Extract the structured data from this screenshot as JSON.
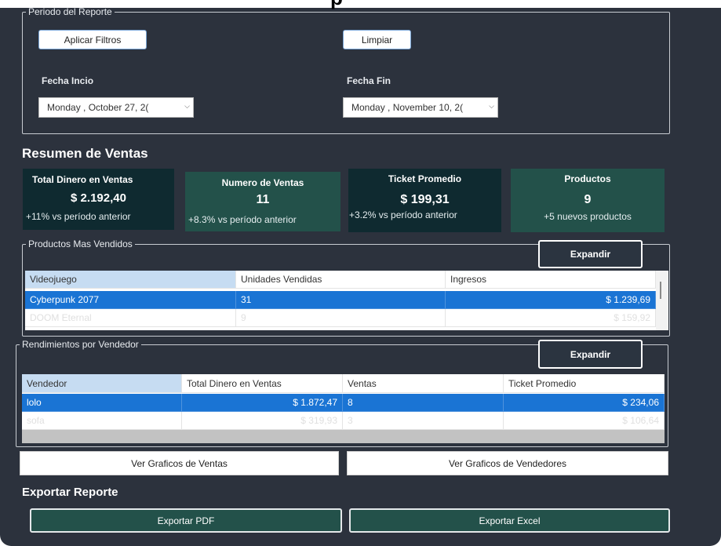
{
  "window": {
    "title_fragment": "p"
  },
  "periodo": {
    "legend": "Periodo del Reporte",
    "apply_label": "Aplicar Filtros",
    "clear_label": "Limpiar",
    "start_label": "Fecha Incio",
    "end_label": "Fecha Fin",
    "start_value": "Monday ,  October  27, 2(",
    "end_value": "Monday  , November 10, 2("
  },
  "resumen": {
    "title": "Resumen de Ventas",
    "cards": [
      {
        "title": "Total Dinero en Ventas",
        "value": "$ 2.192,40",
        "sub": "+11% vs período anterior"
      },
      {
        "title": "Numero de Ventas",
        "value": "11",
        "sub": "+8.3% vs período anterior"
      },
      {
        "title": "Ticket Promedio",
        "value": "$ 199,31",
        "sub": "+3.2% vs período anterior"
      },
      {
        "title": "Productos",
        "value": "9",
        "sub": "+5 nuevos productos"
      }
    ]
  },
  "productos": {
    "legend": "Productos Mas Vendidos",
    "expand_label": "Expandir",
    "columns": [
      "Videojuego",
      "Unidades Vendidas",
      "Ingresos"
    ],
    "rows": [
      [
        "Cyberpunk 2077",
        "31",
        "$ 1.239,69"
      ],
      [
        "DOOM Eternal",
        "9",
        "$ 159,92"
      ]
    ]
  },
  "vendedores": {
    "legend": "Rendimientos por Vendedor",
    "expand_label": "Expandir",
    "columns": [
      "Vendedor",
      "Total Dinero en Ventas",
      "Ventas",
      "Ticket Promedio"
    ],
    "rows": [
      [
        "lolo",
        "$ 1.872,47",
        "8",
        "$ 234,06"
      ],
      [
        "sofa",
        "$ 319,93",
        "3",
        "$ 106,64"
      ]
    ]
  },
  "graficos": {
    "ventas_label": "Ver Graficos de Ventas",
    "vendedores_label": "Ver Graficos de Vendedores"
  },
  "exportar": {
    "title": "Exportar Reporte",
    "pdf_label": "Exportar PDF",
    "excel_label": "Exportar Excel"
  }
}
